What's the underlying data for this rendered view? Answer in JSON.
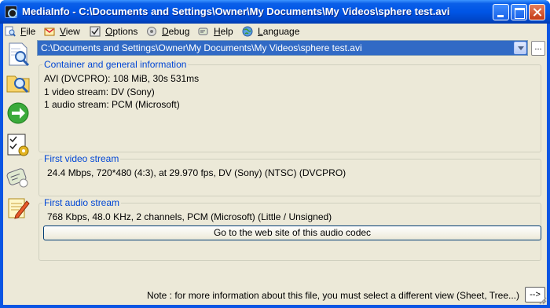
{
  "window": {
    "title": "MediaInfo - C:\\Documents and Settings\\Owner\\My Documents\\My Videos\\sphere test.avi"
  },
  "menu": [
    {
      "label": "File",
      "icon": "file-magnifier-icon"
    },
    {
      "label": "View",
      "icon": "view-icon"
    },
    {
      "label": "Options",
      "icon": "options-icon"
    },
    {
      "label": "Debug",
      "icon": "debug-icon"
    },
    {
      "label": "Help",
      "icon": "help-icon"
    },
    {
      "label": "Language",
      "icon": "globe-icon"
    }
  ],
  "toolbar": [
    {
      "icon": "open-file-icon"
    },
    {
      "icon": "open-folder-icon"
    },
    {
      "icon": "next-arrow-icon"
    },
    {
      "icon": "settings-icon"
    },
    {
      "icon": "help-icon"
    },
    {
      "icon": "notes-icon"
    }
  ],
  "file_combo": {
    "value": "C:\\Documents and Settings\\Owner\\My Documents\\My Videos\\sphere test.avi",
    "browse_label": "..."
  },
  "general": {
    "title": "Container and general information",
    "lines": [
      "AVI (DVCPRO): 108 MiB, 30s 531ms",
      "1 video stream: DV (Sony)",
      "1 audio stream: PCM (Microsoft)"
    ]
  },
  "video": {
    "title": "First video stream",
    "line": "24.4 Mbps, 720*480 (4:3), at 29.970 fps, DV (Sony) (NTSC) (DVCPRO)"
  },
  "audio": {
    "title": "First audio stream",
    "line": "768 Kbps, 48.0 KHz, 2 channels, PCM (Microsoft) (Little / Unsigned)",
    "web_button": "Go to the web site of this audio codec"
  },
  "footer": {
    "note": "Note : for more information about this file, you must select a different view (Sheet, Tree...)",
    "next_label": "-->"
  },
  "colors": {
    "titlebar": "#0055e6",
    "window_bg": "#ece9d8",
    "group_title": "#0046d5",
    "selection": "#316ac5"
  }
}
